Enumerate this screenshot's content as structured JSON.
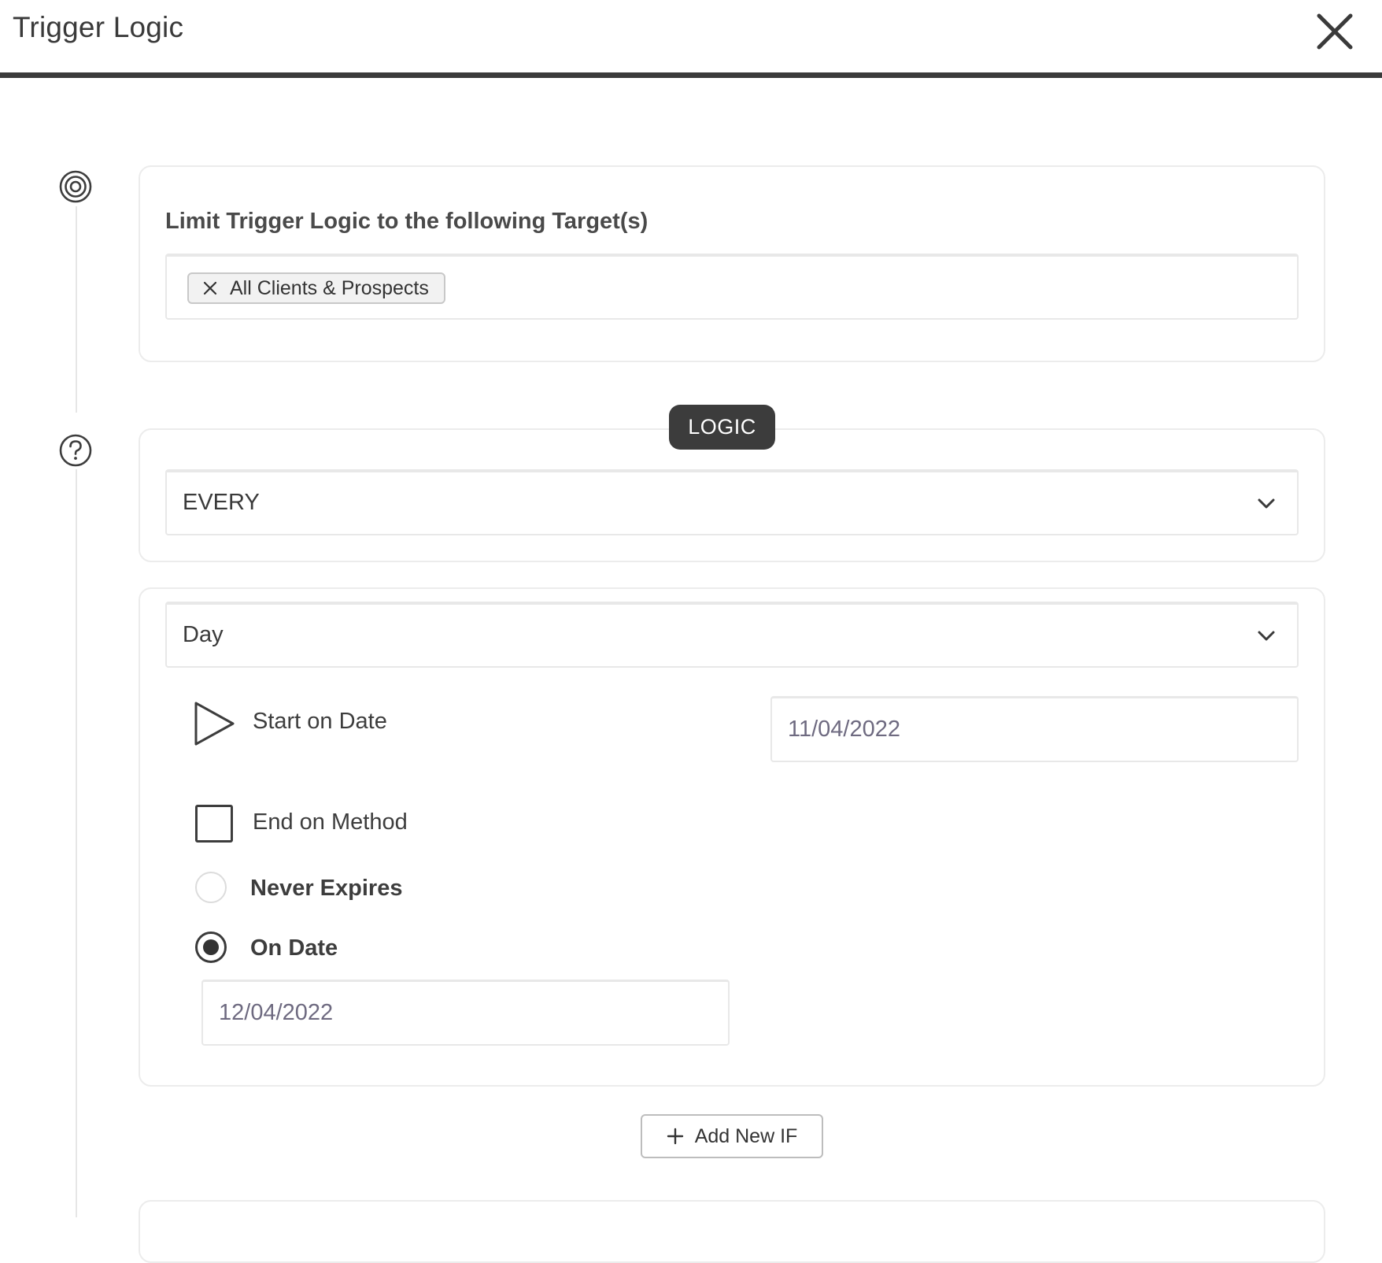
{
  "header": {
    "title": "Trigger Logic",
    "close_icon": "close-icon"
  },
  "target_section": {
    "icon": "target-icon",
    "label": "Limit Trigger Logic to the following Target(s)",
    "tags": [
      {
        "label": "All Clients & Prospects",
        "remove_icon": "remove-tag-icon"
      }
    ]
  },
  "logic_section": {
    "icon": "question-icon",
    "badge": "LOGIC",
    "frequency_select": {
      "value": "EVERY",
      "icon": "chevron-down-icon"
    }
  },
  "schedule_section": {
    "unit_select": {
      "value": "Day",
      "icon": "chevron-down-icon"
    },
    "start": {
      "icon": "play-icon",
      "label": "Start on Date",
      "date_value": "11/04/2022"
    },
    "end": {
      "checkbox_label": "End on Method",
      "checked": false,
      "options": [
        {
          "label": "Never Expires",
          "selected": false
        },
        {
          "label": "On Date",
          "selected": true
        }
      ],
      "date_value": "12/04/2022"
    }
  },
  "actions": {
    "add_if_label": "Add New IF",
    "add_icon": "plus-icon"
  }
}
